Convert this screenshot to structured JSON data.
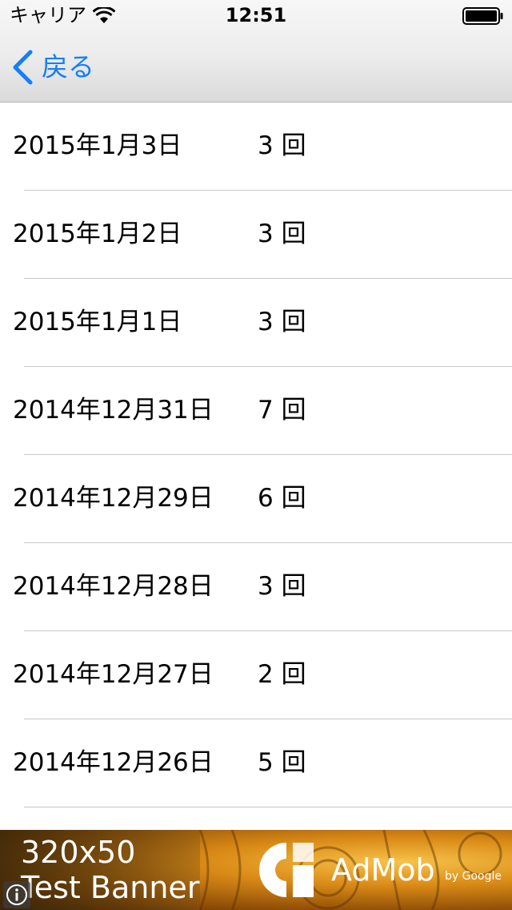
{
  "status_bar": {
    "carrier": "キャリア",
    "time": "12:51"
  },
  "nav": {
    "back_label": "戻る"
  },
  "list": {
    "rows": [
      {
        "date": "2015年1月3日",
        "count": "3 回"
      },
      {
        "date": "2015年1月2日",
        "count": "3 回"
      },
      {
        "date": "2015年1月1日",
        "count": "3 回"
      },
      {
        "date": "2014年12月31日",
        "count": "7 回"
      },
      {
        "date": "2014年12月29日",
        "count": "6 回"
      },
      {
        "date": "2014年12月28日",
        "count": "3 回"
      },
      {
        "date": "2014年12月27日",
        "count": "2 回"
      },
      {
        "date": "2014年12月26日",
        "count": "5 回"
      }
    ]
  },
  "ad": {
    "size_text": "320x50",
    "title_text": "Test Banner",
    "brand": "AdMob",
    "by": "by Google"
  },
  "colors": {
    "accent": "#147efb",
    "separator": "#c8c7cc"
  }
}
